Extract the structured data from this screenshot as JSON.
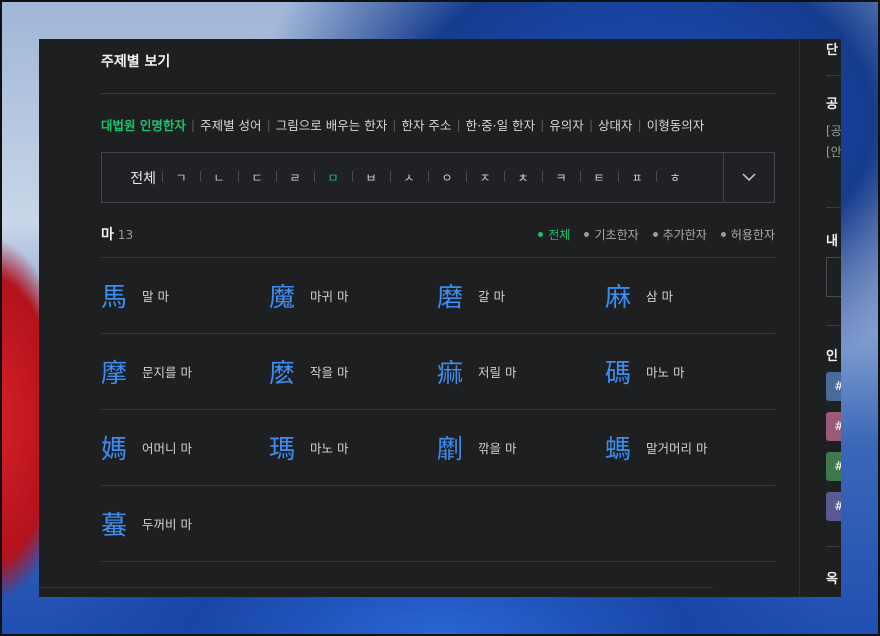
{
  "section_title": "주제별 보기",
  "topic_links": [
    {
      "label": "대법원 인명한자",
      "active": true
    },
    {
      "label": "주제별 성어",
      "active": false
    },
    {
      "label": "그림으로 배우는 한자",
      "active": false
    },
    {
      "label": "한자 주소",
      "active": false
    },
    {
      "label": "한·중·일 한자",
      "active": false
    },
    {
      "label": "유의자",
      "active": false
    },
    {
      "label": "상대자",
      "active": false
    },
    {
      "label": "이형동의자",
      "active": false
    }
  ],
  "consonants": {
    "all_label": "전체",
    "items": [
      "ㄱ",
      "ㄴ",
      "ㄷ",
      "ㄹ",
      "ㅁ",
      "ㅂ",
      "ㅅ",
      "ㅇ",
      "ㅈ",
      "ㅊ",
      "ㅋ",
      "ㅌ",
      "ㅍ",
      "ㅎ"
    ],
    "active": "ㅁ"
  },
  "group": {
    "label": "마",
    "count": "13"
  },
  "filters": [
    {
      "label": "전체",
      "active": true
    },
    {
      "label": "기초한자",
      "active": false
    },
    {
      "label": "추가한자",
      "active": false
    },
    {
      "label": "허용한자",
      "active": false
    }
  ],
  "hanja_list": [
    {
      "hanja": "馬",
      "reading": "말 마"
    },
    {
      "hanja": "魔",
      "reading": "마귀 마"
    },
    {
      "hanja": "磨",
      "reading": "갈 마"
    },
    {
      "hanja": "麻",
      "reading": "삼 마"
    },
    {
      "hanja": "摩",
      "reading": "문지를 마"
    },
    {
      "hanja": "麽",
      "reading": "작을 마"
    },
    {
      "hanja": "痲",
      "reading": "저릴 마"
    },
    {
      "hanja": "碼",
      "reading": "마노 마"
    },
    {
      "hanja": "媽",
      "reading": "어머니 마"
    },
    {
      "hanja": "瑪",
      "reading": "마노 마"
    },
    {
      "hanja": "劘",
      "reading": "깎을 마"
    },
    {
      "hanja": "螞",
      "reading": "말거머리 마"
    },
    {
      "hanja": "蟇",
      "reading": "두꺼비 마"
    }
  ],
  "sidebar": {
    "fragments": [
      "단",
      "공",
      "[공",
      "[안",
      "내",
      "인",
      "옥"
    ],
    "tag_fragments": [
      "#",
      "#",
      "#",
      "#"
    ],
    "tag_colors": [
      "#4a6a9a",
      "#9a5a78",
      "#3f7a4e",
      "#5a5a92"
    ]
  },
  "colors": {
    "accent_green": "#19c36a",
    "hanja_blue": "#3d8df0",
    "panel_bg": "#1e1f21"
  }
}
